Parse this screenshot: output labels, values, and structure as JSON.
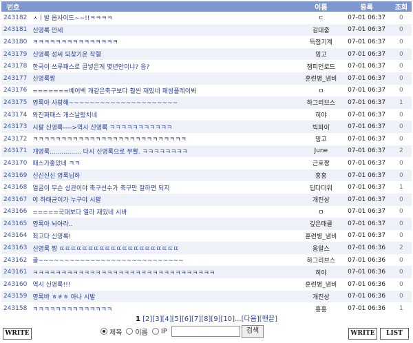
{
  "header": {
    "num": "번호",
    "title": "",
    "name": "이름",
    "date": "등록",
    "hits": "조회"
  },
  "posts": [
    {
      "num": "243182",
      "title": "ㅅㅣ발 옵사이드~~!!ㅋㅋㅋㅋ",
      "name": "ㄷ",
      "date": "07-01 06:37",
      "hits": "0"
    },
    {
      "num": "243181",
      "title": "신영록 만세",
      "name": "김대중",
      "date": "07-01 06:37",
      "hits": "0"
    },
    {
      "num": "243180",
      "title": "ㅋㅋㅋㅋㅋㅋㅋㅋㅋㅋㅋㅋㅋㅋㅋ",
      "name": "득점기계",
      "date": "07-01 06:37",
      "hits": "0"
    },
    {
      "num": "243179",
      "title": "신영록 성씨 되찾기운 작렬",
      "name": "밍고",
      "date": "07-01 06:37",
      "hits": "0"
    },
    {
      "num": "243178",
      "title": "한국이 쓰루패스로 골넣은게 몇년만이냐? 응?",
      "name": "챔피언로드",
      "date": "07-01 06:37",
      "hits": "0"
    },
    {
      "num": "243177",
      "title": "신영록짱",
      "name": "훈련병_냄비",
      "date": "07-01 06:37",
      "hits": "0"
    },
    {
      "num": "243176",
      "title": "=======베어벡 개같은축구보다 훨씬 재밌네 패씽플레이봐",
      "name": "ㅁ",
      "date": "07-01 06:37",
      "hits": "0"
    },
    {
      "num": "243175",
      "title": "영록아 사랑해~~~~~~~~~~~~~~~~~~~~~",
      "name": "하그리브스",
      "date": "07-01 06:37",
      "hits": "1"
    },
    {
      "num": "243174",
      "title": "와진짜패스 개스날렸치네",
      "name": "히야",
      "date": "07-01 06:37",
      "hits": "0"
    },
    {
      "num": "243173",
      "title": "시팔 신영록---->역시 신영록 ㅋㅋㅋㅋㅋㅋㅋㅋㅋㅋㅋ",
      "name": "빅파이",
      "date": "07-01 06:37",
      "hits": "0"
    },
    {
      "num": "243172",
      "title": "ㅋㅋㅋㅋㅋㅋㅋㅋㅋㅋㅋㅋㅋㅋㅋㅋㅋㅋㅋㅋㅋㅋㅋㅋㅋㅋㅋ",
      "name": "밍고",
      "date": "07-01 06:37",
      "hits": "0"
    },
    {
      "num": "243171",
      "title": "개영록................ 다시 신영록으로 부활. ㅋㅋㅋㅋㅋㅋㅋㅋ",
      "name": "June",
      "date": "07-01 06:37",
      "hits": "2"
    },
    {
      "num": "243170",
      "title": "패스가좋았네 ㅋㅋ",
      "name": "근호짱",
      "date": "07-01 06:37",
      "hits": "0"
    },
    {
      "num": "243169",
      "title": "신신신신 영록님하",
      "name": "홍홍",
      "date": "07-01 06:37",
      "hits": "0"
    },
    {
      "num": "243168",
      "title": "얼굴이 무슨 상관이야 축구선수가 축구만 잘하면 되지",
      "name": "딥다더워",
      "date": "07-01 06:37",
      "hits": "1"
    },
    {
      "num": "243167",
      "title": "야 하태균이가 누구야 시팔",
      "name": "개진상",
      "date": "07-01 06:37",
      "hits": "0"
    },
    {
      "num": "243166",
      "title": "=====국대보다 열라 재밌네 시바",
      "name": "ㅁ",
      "date": "07-01 06:37",
      "hits": "0"
    },
    {
      "num": "243165",
      "title": "영록아 놔아라..",
      "name": "깊은태클",
      "date": "07-01 06:37",
      "hits": "0"
    },
    {
      "num": "243164",
      "title": "최고다 신영록!",
      "name": "훈련병_냄비",
      "date": "07-01 06:37",
      "hits": "0"
    },
    {
      "num": "243163",
      "title": "신영록 짱 ㄸㄸㄸㄸㄸㄸㄸㄸㄸㄸㄸㄸㄸㄸㄸㄸㄸㄸㄸㄸㄸ",
      "name": "옹알스",
      "date": "07-01 06:36",
      "hits": "2"
    },
    {
      "num": "243162",
      "title": "골~~~~~~~~~~~~~~~~~~~~~~~~~~~~",
      "name": "하그리브스",
      "date": "07-01 06:36",
      "hits": "0"
    },
    {
      "num": "243161",
      "title": "ㅋㅋㅋㅋㅋㅋㅋㅋㅋㅋㅋㅋㅋㅋㅋㅋㅋㅋㅋㅋㅋㅋㅋㅋㅋㅋㅋㅋㅋㅋㅋㅋ",
      "name": "히야",
      "date": "07-01 06:36",
      "hits": "0"
    },
    {
      "num": "243160",
      "title": "역시 신영록!!!",
      "name": "훈련병_냄비",
      "date": "07-01 06:36",
      "hits": "0"
    },
    {
      "num": "243159",
      "title": "영록바 ㅎㅎㅎ 아나 시발",
      "name": "개진상",
      "date": "07-01 06:36",
      "hits": "0"
    },
    {
      "num": "243158",
      "title": "ㅋㅋㅋㅋㅋㅋㅋㅋㅋㅋㅋㅋㅋㅋ",
      "name": "홍홍",
      "date": "07-01 06:36",
      "hits": "1"
    }
  ],
  "pager": {
    "current": "1",
    "pages": [
      "[2]",
      "[3]",
      "[4]",
      "[5]",
      "[6]",
      "[7]",
      "[8]",
      "[9]",
      "[10]"
    ],
    "ellipsis": "...",
    "next": "[다음]",
    "last": "[맨끝]"
  },
  "buttons": {
    "write_left": "WRITE",
    "write_right": "WRITE",
    "list": "LIST"
  },
  "search": {
    "opt_title": "제목",
    "opt_name": "이름",
    "opt_ip": "IP",
    "input_value": "",
    "button": "검색"
  }
}
